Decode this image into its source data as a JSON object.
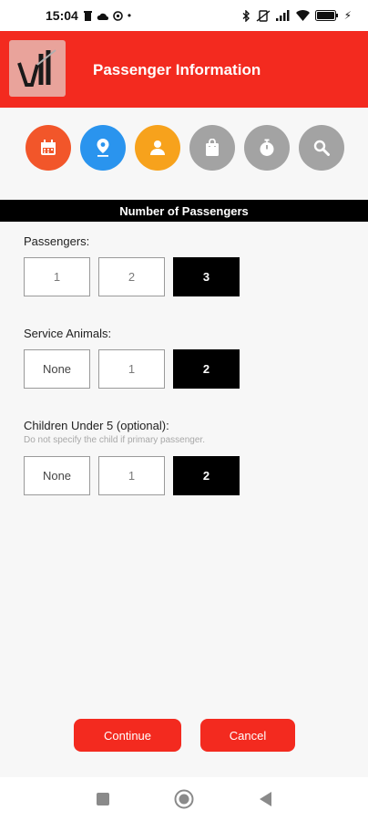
{
  "status_bar": {
    "time": "15:04",
    "battery": ""
  },
  "header": {
    "title": "Passenger Information",
    "logo_icon": "app-logo-icon"
  },
  "steps": [
    {
      "name": "calendar",
      "color": "#f2562a"
    },
    {
      "name": "location",
      "color": "#2a94ee"
    },
    {
      "name": "person",
      "color": "#f7a21c"
    },
    {
      "name": "bag",
      "color": "#a3a3a3"
    },
    {
      "name": "timer",
      "color": "#a3a3a3"
    },
    {
      "name": "search",
      "color": "#a3a3a3"
    }
  ],
  "section": {
    "title": "Number of Passengers"
  },
  "passengers": {
    "label": "Passengers:",
    "options": [
      "1",
      "2",
      "3"
    ],
    "selected": "3"
  },
  "service_animals": {
    "label": "Service Animals:",
    "options": [
      "None",
      "1",
      "2"
    ],
    "selected": "2"
  },
  "children": {
    "label": "Children Under 5 (optional):",
    "note": "Do not specify the child if primary passenger.",
    "options": [
      "None",
      "1",
      "2"
    ],
    "selected": "2"
  },
  "actions": {
    "continue_label": "Continue",
    "cancel_label": "Cancel"
  },
  "colors": {
    "brand_red": "#f32a1f",
    "selected": "#000000"
  }
}
